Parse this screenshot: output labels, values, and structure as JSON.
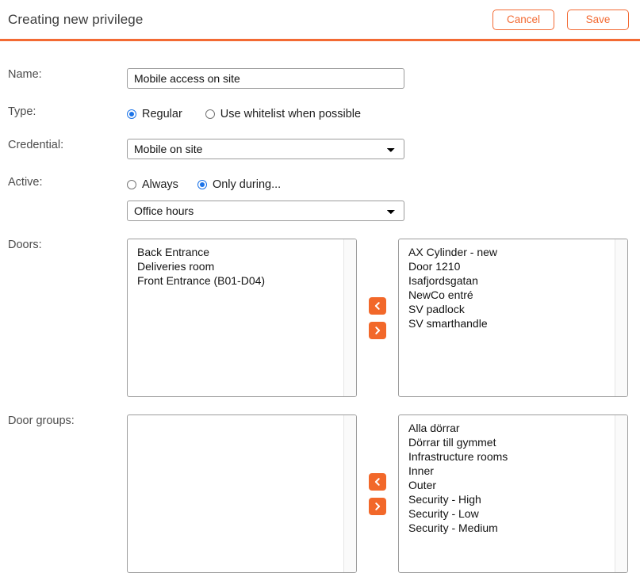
{
  "header": {
    "title": "Creating new privilege",
    "cancel_label": "Cancel",
    "save_label": "Save",
    "accent_color": "#f36a33"
  },
  "form": {
    "name": {
      "label": "Name:",
      "value": "Mobile access on site",
      "placeholder": ""
    },
    "type": {
      "label": "Type:",
      "options": [
        {
          "label": "Regular",
          "selected": true
        },
        {
          "label": "Use whitelist when possible",
          "selected": false
        }
      ]
    },
    "credential": {
      "label": "Credential:",
      "value": "Mobile on site"
    },
    "active": {
      "label": "Active:",
      "options": [
        {
          "label": "Always",
          "selected": false
        },
        {
          "label": "Only during...",
          "selected": true
        }
      ],
      "schedule_value": "Office hours"
    },
    "doors": {
      "label": "Doors:",
      "selected_items": [
        "Back Entrance",
        "Deliveries room",
        "Front Entrance (B01-D04)"
      ],
      "available_items": [
        "AX Cylinder - new",
        "Door 1210",
        "Isafjordsgatan",
        "NewCo entré",
        "SV padlock",
        "SV smarthandle"
      ],
      "move_left_icon": "chevron-left-icon",
      "move_right_icon": "chevron-right-icon"
    },
    "door_groups": {
      "label": "Door groups:",
      "selected_items": [],
      "available_items": [
        "Alla dörrar",
        "Dörrar till gymmet",
        "Infrastructure rooms",
        "Inner",
        "Outer",
        "Security - High",
        "Security - Low",
        "Security - Medium"
      ],
      "move_left_icon": "chevron-left-icon",
      "move_right_icon": "chevron-right-icon"
    }
  },
  "colors": {
    "accent_orange": "#f2682a",
    "radio_blue": "#1b73e8",
    "label_gray": "#4c4c4c"
  }
}
